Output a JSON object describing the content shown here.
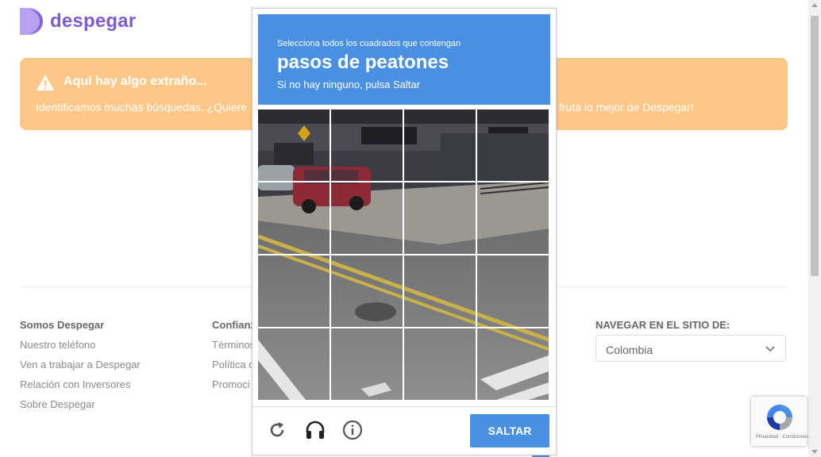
{
  "brand": {
    "name": "despegar",
    "color": "#7d5bd1"
  },
  "alert": {
    "title": "Aquí hay algo extraño...",
    "text_left": "Identificamos muchas búsquedas. ¿Quiere",
    "text_right": "fruta lo mejor de Despegar!",
    "icon": "warning-icon",
    "color": "#fdc788"
  },
  "footer": {
    "col1": {
      "heading": "Somos Despegar",
      "links": [
        "Nuestro teléfono",
        "Ven a trabajar a Despegar",
        "Relación con Inversores",
        "Sobre Despegar"
      ]
    },
    "col2": {
      "heading": "Confianz",
      "links": [
        "Términos",
        "Política c",
        "Promoci"
      ]
    },
    "navigate": {
      "title": "NAVEGAR EN EL SITIO DE:",
      "selected": "Colombia"
    }
  },
  "captcha": {
    "header_sub": "Selecciona todos los cuadrados que contengan",
    "header_main": "pasos de peatones",
    "header_hint": "Si no hay ninguno, pulsa Saltar",
    "header_color": "#4a90e2",
    "skip_label": "SALTAR",
    "controls": [
      "reload-icon",
      "audio-icon",
      "info-icon"
    ]
  },
  "recaptcha_badge": {
    "terms": "Privacidad - Condiciones"
  }
}
